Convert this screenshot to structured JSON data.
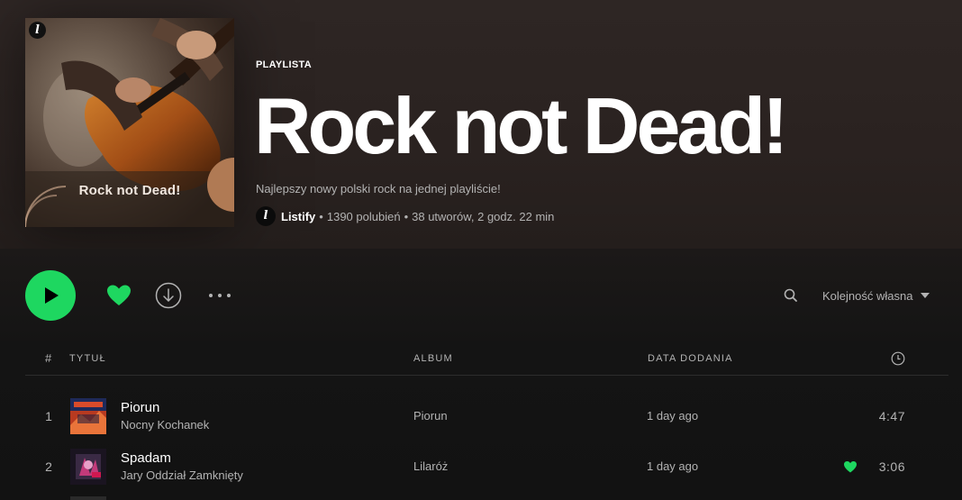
{
  "playlist": {
    "type_label": "PLAYLISTA",
    "title": "Rock not Dead!",
    "cover_title": "Rock not Dead!",
    "description": "Najlepszy nowy polski rock na jednej playliście!",
    "owner": "Listify",
    "owner_initial": "l",
    "likes": "1390 polubień",
    "summary": "38 utworów, 2 godz. 22 min",
    "separator": "•"
  },
  "actions": {
    "play": "play-icon",
    "like": "heart-icon",
    "download": "download-icon",
    "more": "more-icon",
    "search": "search-icon",
    "sort_label": "Kolejność własna"
  },
  "columns": {
    "number": "#",
    "title": "TYTUŁ",
    "album": "ALBUM",
    "date_added": "DATA DODANIA",
    "duration_icon": "clock-icon"
  },
  "tracks": [
    {
      "index": "1",
      "title": "Piorun",
      "artist": "Nocny Kochanek",
      "album": "Piorun",
      "added": "1 day ago",
      "duration": "4:47",
      "liked": false
    },
    {
      "index": "2",
      "title": "Spadam",
      "artist": "Jary Oddział Zamknięty",
      "album": "Lilaróż",
      "added": "1 day ago",
      "duration": "3:06",
      "liked": true
    }
  ],
  "colors": {
    "accent": "#1ed760",
    "background": "#121212",
    "header_bg": "#2e2624",
    "muted_text": "#b3b3b3"
  }
}
